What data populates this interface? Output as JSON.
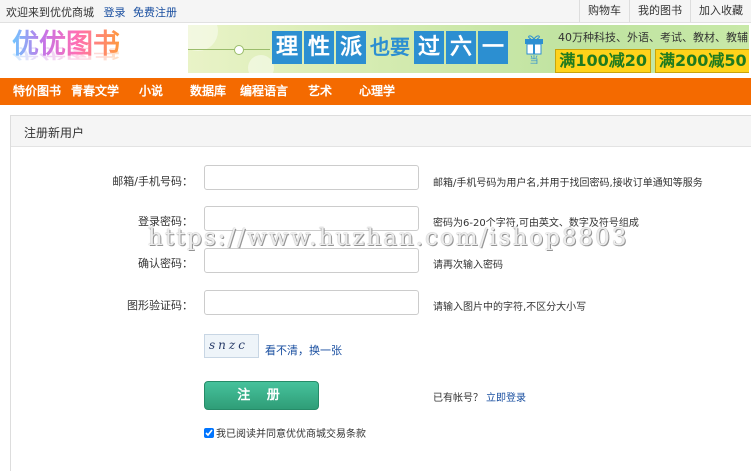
{
  "topbar": {
    "welcome": "欢迎来到优优商城",
    "login": "登录",
    "register": "免费注册",
    "links": [
      "购物车",
      "我的图书",
      "加入收藏"
    ]
  },
  "header": {
    "logo_text": "优优图书",
    "promo_chars": [
      "理",
      "性",
      "派",
      "也要",
      "过",
      "六",
      "一"
    ],
    "promo_gift_label": "当",
    "promo_line1": "40万种科技、外语、考试、教材、教辅",
    "promo_deal1": "满100减20",
    "promo_deal2": "满200减50"
  },
  "nav": {
    "items": [
      "特价图书",
      "青春文学",
      "小说",
      "数据库",
      "编程语言",
      "艺术",
      "心理学"
    ]
  },
  "form": {
    "title": "注册新用户",
    "email_label": "邮箱/手机号码：",
    "email_hint": "邮箱/手机号码为用户名,并用于找回密码,接收订单通知等服务",
    "password_label": "登录密码：",
    "password_hint": "密码为6-20个字符,可由英文、数字及符号组成",
    "confirm_label": "确认密码：",
    "confirm_hint": "请再次输入密码",
    "captcha_label": "图形验证码：",
    "captcha_hint": "请输入图片中的字符,不区分大小写",
    "captcha_text": "snzc",
    "refresh_text": "看不清，换一张",
    "submit_label": "注 册",
    "have_account": "已有帐号？",
    "login_now": "立即登录",
    "agree_text": "我已阅读并同意优优商城交易条款"
  },
  "watermark": "https://www.huzhan.com/ishop8803",
  "colors": {
    "nav_bg": "#f46a00",
    "button_green": "#2f9d77",
    "link_blue": "#1a4fa0",
    "promo_blue": "#2c8fd1"
  }
}
